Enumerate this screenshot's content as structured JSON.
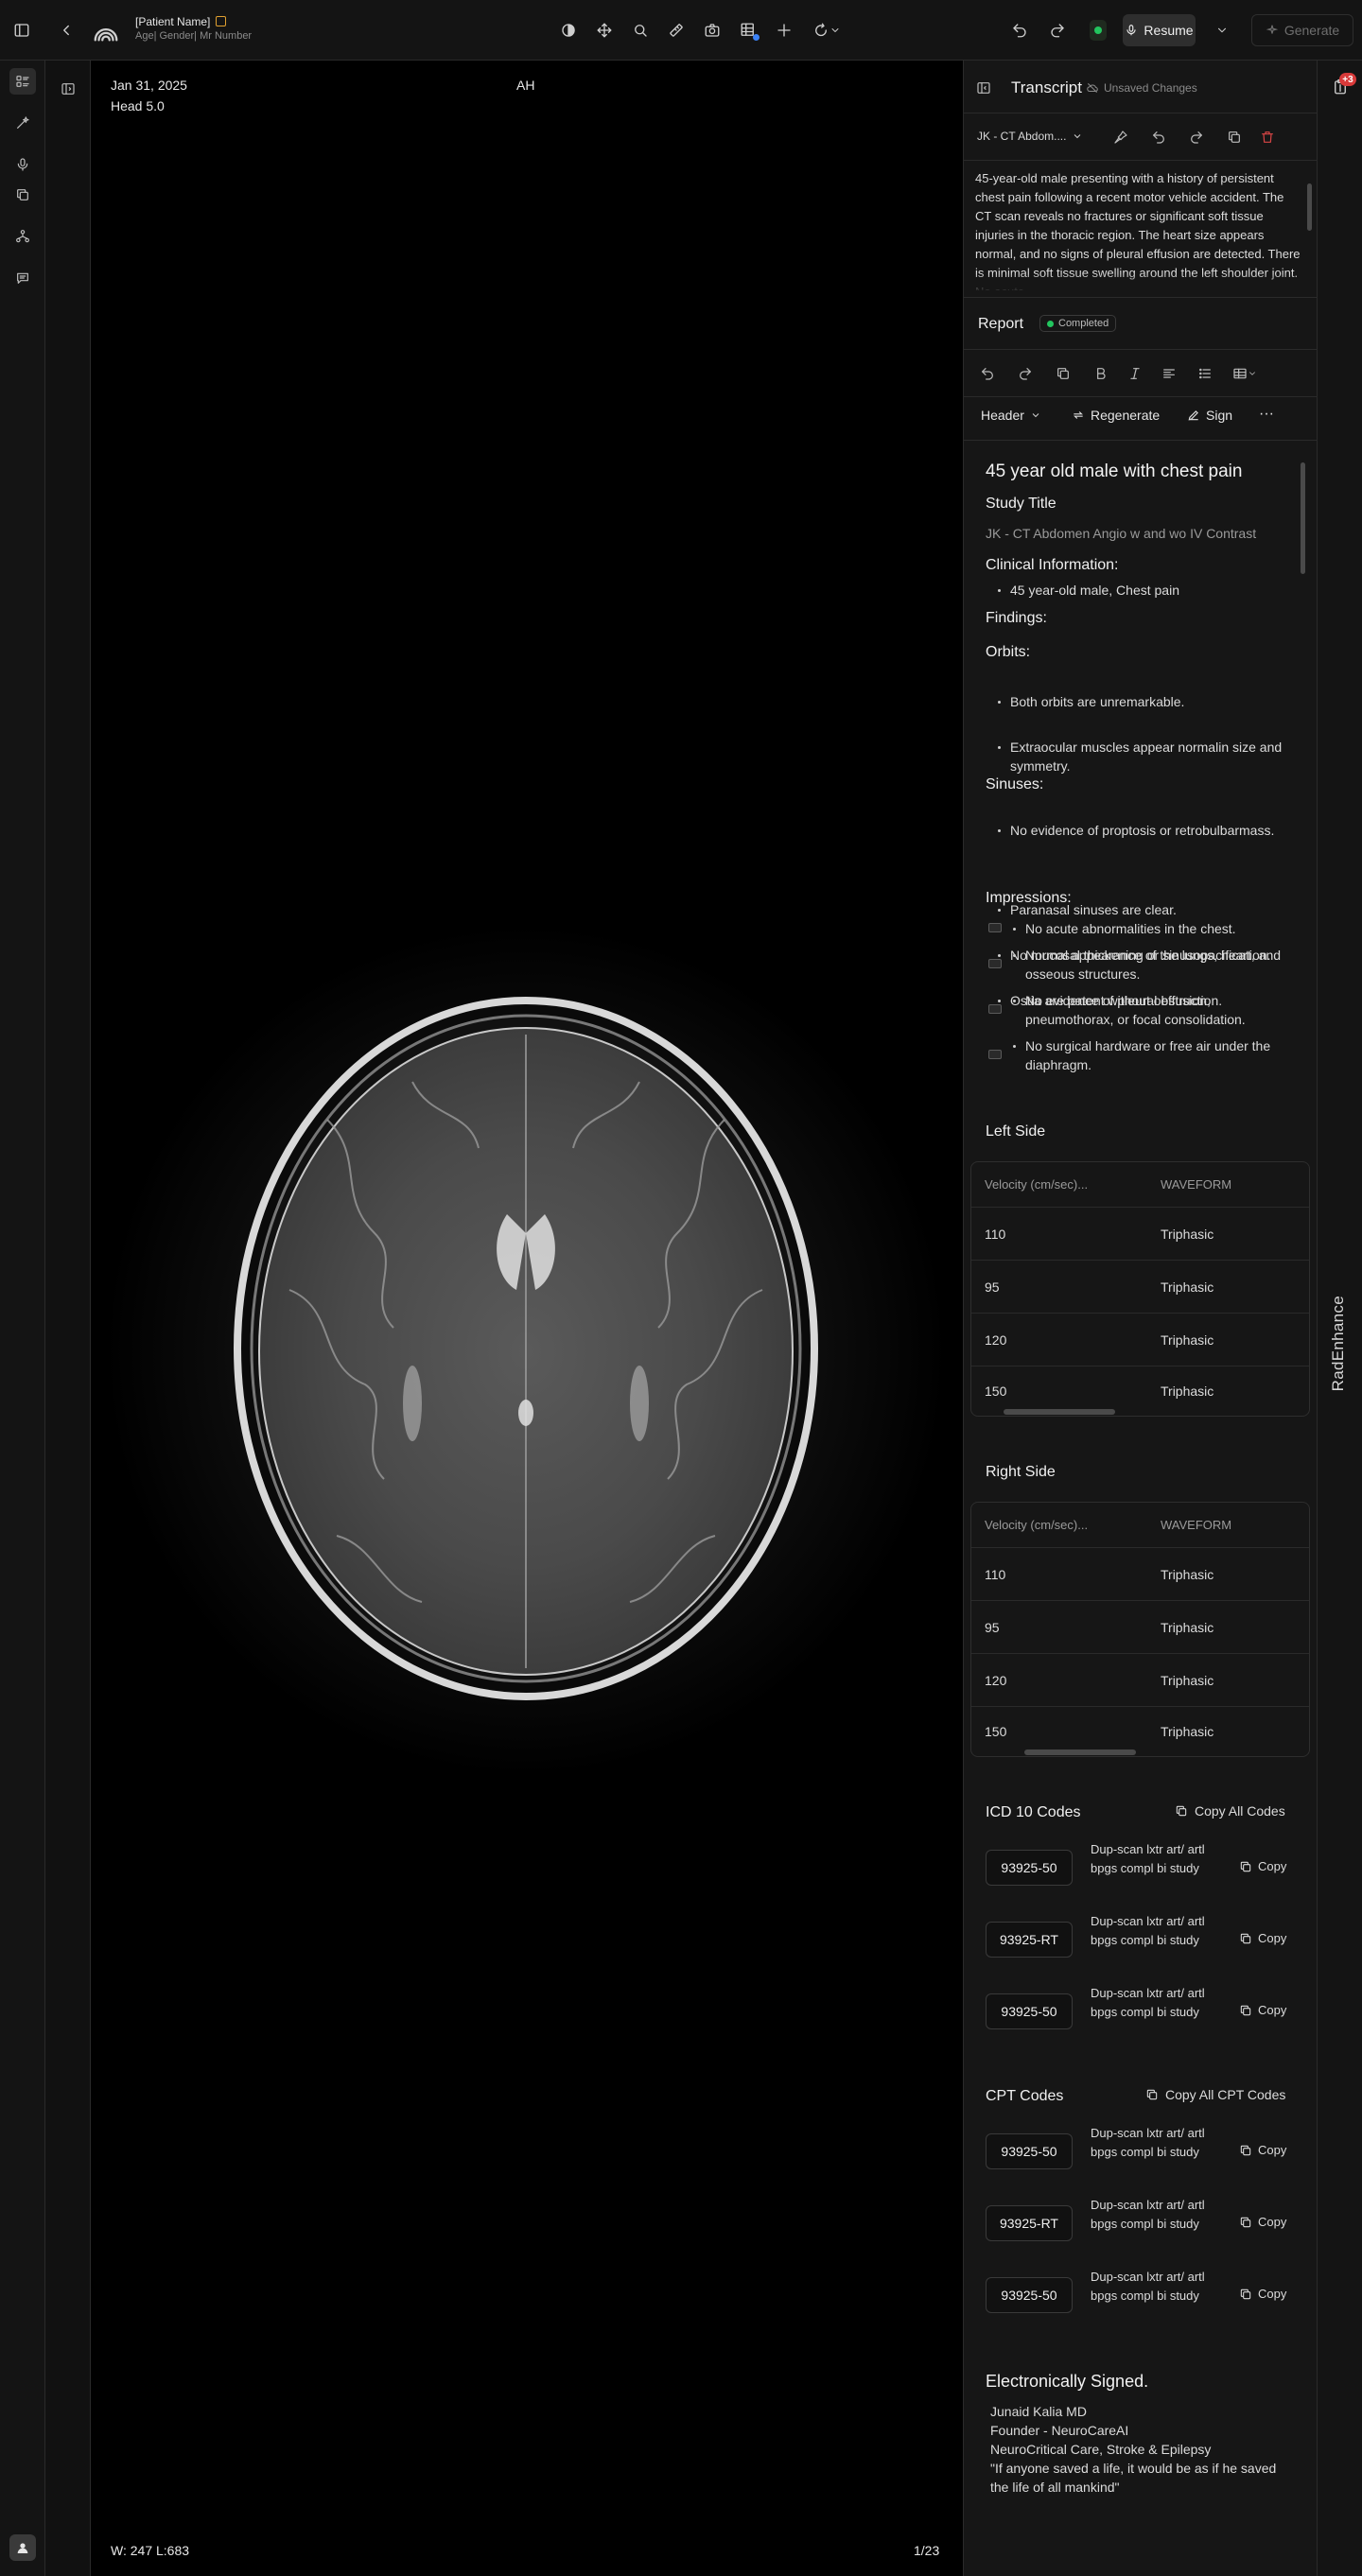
{
  "header": {
    "patient_name": "[Patient Name]",
    "patient_sub": "Age| Gender| Mr Number",
    "resume_label": "Resume",
    "generate_label": "Generate"
  },
  "viewer": {
    "date": "Jan 31, 2025",
    "series": "Head 5.0",
    "orientation": "AH",
    "window_level": "W: 247  L:683",
    "image_index": "1/23"
  },
  "transcript": {
    "title": "Transcript",
    "status": "Unsaved Changes",
    "study_select": "JK - CT Abdom....",
    "text": "45-year-old male presenting with a history of persistent chest pain following a recent motor vehicle accident. The CT scan reveals no fractures or significant soft tissue injuries in the thoracic region. The heart size appears normal, and no signs of pleural effusion are detected. There is minimal soft tissue swelling around the left shoulder joint. No acute"
  },
  "report": {
    "label": "Report",
    "status": "Completed",
    "header_select": "Header",
    "regenerate": "Regenerate",
    "sign": "Sign",
    "more": "···",
    "heading": "45 year old male with chest pain",
    "study_title_label": "Study Title",
    "study_title": "JK - CT Abdomen Angio w and wo IV Contrast",
    "clinical_label": "Clinical Information:",
    "clinical": [
      "45 year-old male, Chest pain"
    ],
    "findings_label": "Findings:",
    "orbits_label": "Orbits:",
    "orbits": [
      "Both orbits are unremarkable.",
      "Extraocular muscles appear normalin size and symmetry.",
      "No evidence of proptosis or retrobulbarmass."
    ],
    "sinuses_label": "Sinuses:",
    "sinuses": [
      "Paranasal sinuses are clear.",
      "No mucosal thickening or sinusopacification.",
      "Ostia are patent without obstruction."
    ],
    "impressions_label": "Impressions:",
    "impressions": [
      "No acute abnormalities in the chest.",
      "Normal appearance of the lungs, heart, and osseous structures.",
      "No evidence of pleural effusion, pneumothorax, or focal consolidation.",
      "No surgical hardware or free air under the diaphragm."
    ]
  },
  "left_side": {
    "title": "Left Side",
    "headers": [
      "Velocity (cm/sec)...",
      "WAVEFORM"
    ],
    "rows": [
      [
        "110",
        "Triphasic"
      ],
      [
        "95",
        "Triphasic"
      ],
      [
        "120",
        "Triphasic"
      ],
      [
        "150",
        "Triphasic"
      ]
    ]
  },
  "right_side": {
    "title": "Right Side",
    "headers": [
      "Velocity (cm/sec)...",
      "WAVEFORM"
    ],
    "rows": [
      [
        "110",
        "Triphasic"
      ],
      [
        "95",
        "Triphasic"
      ],
      [
        "120",
        "Triphasic"
      ],
      [
        "150",
        "Triphasic"
      ]
    ]
  },
  "icd": {
    "title": "ICD 10 Codes",
    "copy_all": "Copy All Codes",
    "codes": [
      {
        "code": "93925-50",
        "desc": "Dup-scan lxtr art/ artl bpgs compl bi study",
        "copy": "Copy"
      },
      {
        "code": "93925-RT",
        "desc": "Dup-scan lxtr art/ artl bpgs compl bi study",
        "copy": "Copy"
      },
      {
        "code": "93925-50",
        "desc": "Dup-scan lxtr art/ artl bpgs compl bi study",
        "copy": "Copy"
      }
    ]
  },
  "cpt": {
    "title": "CPT Codes",
    "copy_all": "Copy All CPT Codes",
    "codes": [
      {
        "code": "93925-50",
        "desc": "Dup-scan lxtr art/ artl bpgs compl bi study",
        "copy": "Copy"
      },
      {
        "code": "93925-RT",
        "desc": "Dup-scan lxtr art/ artl bpgs compl bi study",
        "copy": "Copy"
      },
      {
        "code": "93925-50",
        "desc": "Dup-scan lxtr art/ artl bpgs compl bi study",
        "copy": "Copy"
      }
    ]
  },
  "signature": {
    "title": "Electronically Signed.",
    "lines": [
      "Junaid Kalia MD",
      "Founder - NeuroCareAI",
      "NeuroCritical Care, Stroke & Epilepsy",
      "\"If anyone saved a life, it would be as if he saved the life of all mankind\""
    ]
  },
  "rail": {
    "label": "RadEnhance",
    "badge": "+3"
  },
  "icons": [
    "sidebar-toggle-icon",
    "back-icon",
    "logo-icon",
    "contrast-icon",
    "move-icon",
    "zoom-icon",
    "measure-icon",
    "camera-icon",
    "grid-icon",
    "plus-icon",
    "rotate-icon",
    "undo-icon",
    "redo-icon",
    "mic-icon",
    "sparkle-icon"
  ],
  "colors": {
    "accent_green": "#22c55e",
    "badge_red": "#d83a3a",
    "flag_orange": "#e0a030",
    "delete_red": "#d84545"
  }
}
